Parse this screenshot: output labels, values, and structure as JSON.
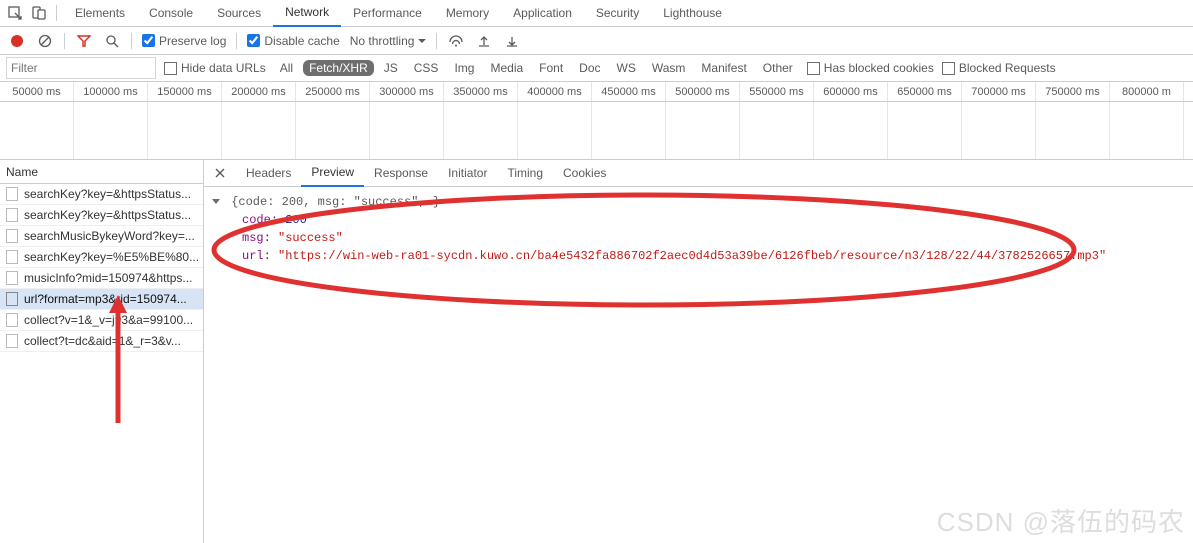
{
  "devtools": {
    "tabs": [
      {
        "label": "Elements",
        "active": false
      },
      {
        "label": "Console",
        "active": false
      },
      {
        "label": "Sources",
        "active": false
      },
      {
        "label": "Network",
        "active": true
      },
      {
        "label": "Performance",
        "active": false
      },
      {
        "label": "Memory",
        "active": false
      },
      {
        "label": "Application",
        "active": false
      },
      {
        "label": "Security",
        "active": false
      },
      {
        "label": "Lighthouse",
        "active": false
      }
    ]
  },
  "toolbar": {
    "preserve_log_label": "Preserve log",
    "preserve_log_checked": true,
    "disable_cache_label": "Disable cache",
    "disable_cache_checked": true,
    "throttling_label": "No throttling"
  },
  "filter": {
    "placeholder": "Filter",
    "hide_data_urls_label": "Hide data URLs",
    "chips": [
      "All",
      "Fetch/XHR",
      "JS",
      "CSS",
      "Img",
      "Media",
      "Font",
      "Doc",
      "WS",
      "Wasm",
      "Manifest",
      "Other"
    ],
    "active_chip": "Fetch/XHR",
    "has_blocked_cookies_label": "Has blocked cookies",
    "blocked_requests_label": "Blocked Requests"
  },
  "timeline": {
    "ticks": [
      "50000 ms",
      "100000 ms",
      "150000 ms",
      "200000 ms",
      "250000 ms",
      "300000 ms",
      "350000 ms",
      "400000 ms",
      "450000 ms",
      "500000 ms",
      "550000 ms",
      "600000 ms",
      "650000 ms",
      "700000 ms",
      "750000 ms",
      "800000 m"
    ]
  },
  "request_list": {
    "header": "Name",
    "rows": [
      {
        "text": "searchKey?key=&httpsStatus...",
        "selected": false
      },
      {
        "text": "searchKey?key=&httpsStatus...",
        "selected": false
      },
      {
        "text": "searchMusicBykeyWord?key=...",
        "selected": false
      },
      {
        "text": "searchKey?key=%E5%BE%80...",
        "selected": false
      },
      {
        "text": "musicInfo?mid=150974&https...",
        "selected": false
      },
      {
        "text": "url?format=mp3&rid=150974...",
        "selected": true
      },
      {
        "text": "collect?v=1&_v=j93&a=99100...",
        "selected": false
      },
      {
        "text": "collect?t=dc&aid=1&_r=3&v...",
        "selected": false
      }
    ]
  },
  "preview": {
    "tabs": [
      {
        "label": "Headers",
        "active": false
      },
      {
        "label": "Preview",
        "active": true
      },
      {
        "label": "Response",
        "active": false
      },
      {
        "label": "Initiator",
        "active": false
      },
      {
        "label": "Timing",
        "active": false
      },
      {
        "label": "Cookies",
        "active": false
      }
    ],
    "json": {
      "summary": "{code: 200, msg: \"success\",…}",
      "code_key": "code",
      "code_val": "200",
      "msg_key": "msg",
      "msg_val": "\"success\"",
      "url_key": "url",
      "url_val": "\"https://win-web-ra01-sycdn.kuwo.cn/ba4e5432fa886702f2aec0d4d53a39be/6126fbeb/resource/n3/128/22/44/3782526657.mp3\""
    }
  },
  "watermark": "CSDN @落伍的码农"
}
